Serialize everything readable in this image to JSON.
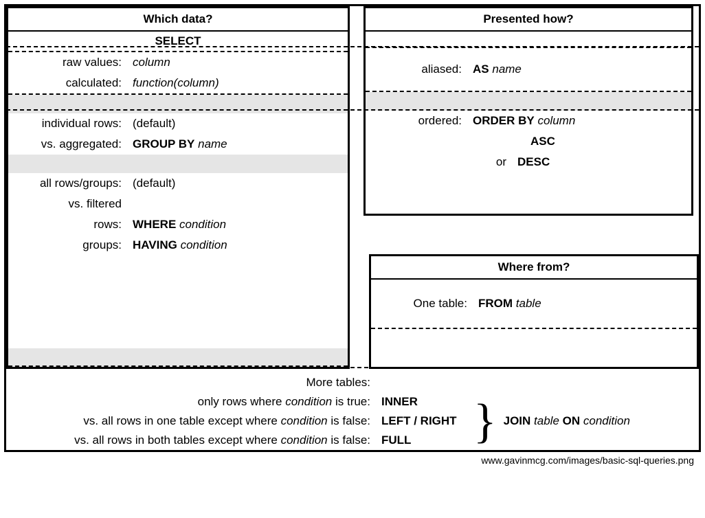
{
  "which_data": {
    "title": "Which data?",
    "select": "SELECT",
    "raw_values_label": "raw values:",
    "raw_values_value": "column",
    "calculated_label": "calculated:",
    "calculated_value": "function(column)",
    "individual_rows_label": "individual rows:",
    "individual_rows_value": "(default)",
    "aggregated_label": "vs. aggregated:",
    "group_by_kw": "GROUP BY",
    "group_by_arg": "name",
    "all_rows_label": "all rows/groups:",
    "all_rows_value": "(default)",
    "filtered_label": "vs. filtered",
    "rows_label": "rows:",
    "where_kw": "WHERE",
    "where_arg": "condition",
    "groups_label": "groups:",
    "having_kw": "HAVING",
    "having_arg": "condition"
  },
  "presented": {
    "title": "Presented how?",
    "aliased_label": "aliased:",
    "as_kw": "AS",
    "as_arg": "name",
    "ordered_label": "ordered:",
    "order_by_kw": "ORDER BY",
    "order_by_arg": "column",
    "asc": "ASC",
    "or_label": "or",
    "desc": "DESC"
  },
  "where_from": {
    "title": "Where from?",
    "one_table_label": "One table:",
    "from_kw": "FROM",
    "from_arg": "table"
  },
  "joins": {
    "more_tables_label": "More tables:",
    "inner_label": "only rows where condition is true:",
    "inner_kw": "INNER",
    "leftright_label": "vs. all rows in one table except where condition is false:",
    "leftright_kw": "LEFT / RIGHT",
    "full_label": "vs. all rows in both tables except where condition is false:",
    "full_kw": "FULL",
    "join_kw": "JOIN",
    "join_arg1": "table",
    "on_kw": "ON",
    "join_arg2": "condition"
  },
  "source": "www.gavinmcg.com/images/basic-sql-queries.png"
}
